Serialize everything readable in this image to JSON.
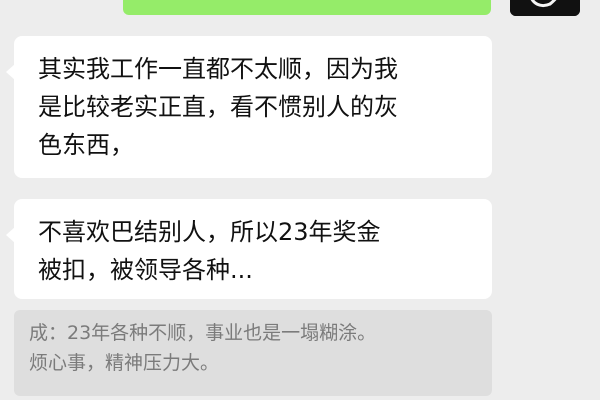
{
  "chat": {
    "messages": [
      {
        "lines": [
          "其实我工作一直都不太顺，因为我",
          "是比较老实正直，看不惯别人的灰",
          "色东西，"
        ]
      },
      {
        "lines": [
          "不喜欢巴结别人，所以23年奖金",
          "被扣，被领导各种..."
        ]
      }
    ],
    "quote": {
      "lines": [
        "成：23年各种不顺，事业也是一塌糊涂。",
        "烦心事，精神压力大。"
      ]
    }
  },
  "colors": {
    "background": "#ededed",
    "sent_bubble": "#95ec69",
    "received_bubble": "#ffffff",
    "quote_background": "#dedede",
    "quote_text": "#7b7b7b"
  }
}
